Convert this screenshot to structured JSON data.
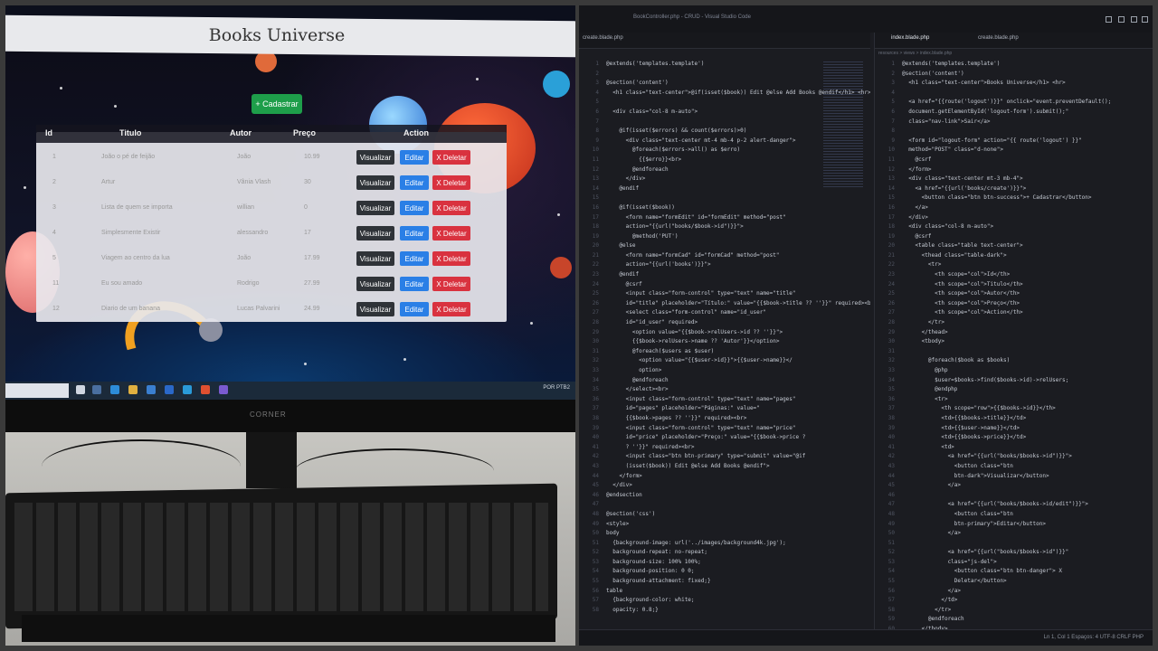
{
  "left": {
    "site_title": "Books Universe",
    "cadastrar_label": "+ Cadastrar",
    "headers": [
      "Id",
      "Titulo",
      "Autor",
      "Preço",
      "Action"
    ],
    "rows": [
      {
        "id": "1",
        "titulo": "João o pé de feijão",
        "autor": "João",
        "preco": "10.99"
      },
      {
        "id": "2",
        "titulo": "Artur",
        "autor": "Vânia Vlash",
        "preco": "30"
      },
      {
        "id": "3",
        "titulo": "Lista de quem se importa",
        "autor": "willian",
        "preco": "0"
      },
      {
        "id": "4",
        "titulo": "Simplesmente Existir",
        "autor": "alessandro",
        "preco": "17"
      },
      {
        "id": "5",
        "titulo": "Viagem ao centro da lua",
        "autor": "João",
        "preco": "17.99"
      },
      {
        "id": "11",
        "titulo": "Eu sou amado",
        "autor": "Rodrigo",
        "preco": "27.99"
      },
      {
        "id": "12",
        "titulo": "Diario de um banana",
        "autor": "Lucas Palvarini",
        "preco": "24.99"
      }
    ],
    "actions": {
      "view": "Visualizar",
      "edit": "Editar",
      "delete": "X Deletar"
    },
    "monitor_brand": "CORNER",
    "taskbar_tray": "POR PTB2"
  },
  "right": {
    "window_title": "BookController.php - CRUD - Visual Studio Code",
    "left_tab": "create.blade.php",
    "right_tabs": [
      "index.blade.php",
      "create.blade.php"
    ],
    "right_crumb": "resources > views > index.blade.php",
    "status": "Ln 1, Col 1   Espaços: 4   UTF-8   CRLF   PHP",
    "left_code": [
      "@extends('templates.template')",
      "",
      "@section('content')",
      "  <h1 class=\"text-center\">@if(isset($book)) Edit @else Add Books @endif</h1> <hr>",
      "",
      "  <div class=\"col-8 m-auto\">",
      "",
      "    @if(isset($errors) && count($errors)>0)",
      "      <div class=\"text-center mt-4 mb-4 p-2 alert-danger\">",
      "        @foreach($errors->all() as $erro)",
      "          {{$erro}}<br>",
      "        @endforeach",
      "      </div>",
      "    @endif",
      "",
      "    @if(isset($book))",
      "      <form name=\"formEdit\" id=\"formEdit\" method=\"post\"",
      "      action=\"{{url(\"books/$book->id\")}}\">",
      "        @method('PUT')",
      "    @else",
      "      <form name=\"formCad\" id=\"formCad\" method=\"post\"",
      "      action=\"{{url('books')}}\">",
      "    @endif",
      "      @csrf",
      "      <input class=\"form-control\" type=\"text\" name=\"title\"",
      "      id=\"title\" placeholder=\"Título:\" value=\"{{$book->title ?? ''}}\" required><br>",
      "      <select class=\"form-control\" name=\"id_user\"",
      "      id=\"id_user\" required>",
      "        <option value=\"{{$book->relUsers->id ?? ''}}\">",
      "        {{$book->relUsers->name ?? 'Autor'}}</option>",
      "        @foreach($users as $user)",
      "          <option value=\"{{$user->id}}\">{{$user->name}}</",
      "          option>",
      "        @endforeach",
      "      </select><br>",
      "      <input class=\"form-control\" type=\"text\" name=\"pages\"",
      "      id=\"pages\" placeholder=\"Páginas:\" value=\"",
      "      {{$book->pages ?? ''}}\" required><br>",
      "      <input class=\"form-control\" type=\"text\" name=\"price\"",
      "      id=\"price\" placeholder=\"Preço:\" value=\"{{$book->price ?",
      "      ? ''}}\" required><br>",
      "      <input class=\"btn btn-primary\" type=\"submit\" value=\"@if",
      "      (isset($book)) Edit @else Add Books @endif\">",
      "    </form>",
      "  </div>",
      "@endsection",
      "",
      "@section('css')",
      "<style>",
      "body",
      "  {background-image: url('../images/background4k.jpg');",
      "  background-repeat: no-repeat;",
      "  background-size: 100% 100%;",
      "  background-position: 0 0;",
      "  background-attachment: fixed;}",
      "table",
      "  {background-color: white;",
      "  opacity: 0.8;}"
    ],
    "right_code": [
      "@extends('templates.template')",
      "@section('content')",
      "  <h1 class=\"text-center\">Books Universe</h1> <hr>",
      "",
      "  <a href=\"{{route('logout')}}\" onclick=\"event.preventDefault();",
      "  document.getElementById('logout-form').submit();\"",
      "  class=\"nav-link\">Sair</a>",
      "",
      "  <form id=\"logout-form\" action=\"{{ route('logout') }}\"",
      "  method=\"POST\" class=\"d-none\">",
      "    @csrf",
      "  </form>",
      "  <div class=\"text-center mt-3 mb-4\">",
      "    <a href=\"{{url('books/create')}}\">",
      "      <button class=\"btn btn-success\">+ Cadastrar</button>",
      "    </a>",
      "  </div>",
      "  <div class=\"col-8 m-auto\">",
      "    @csrf",
      "    <table class=\"table text-center\">",
      "      <thead class=\"table-dark\">",
      "        <tr>",
      "          <th scope=\"col\">Id</th>",
      "          <th scope=\"col\">Titulo</th>",
      "          <th scope=\"col\">Autor</th>",
      "          <th scope=\"col\">Preço</th>",
      "          <th scope=\"col\">Action</th>",
      "        </tr>",
      "      </thead>",
      "      <tbody>",
      "",
      "        @foreach($book as $books)",
      "          @php",
      "          $user=$books->find($books->id)->relUsers;",
      "          @endphp",
      "          <tr>",
      "            <th scope=\"row\">{{$books->id}}</th>",
      "            <td>{{$books->title}}</td>",
      "            <td>{{$user->name}}</td>",
      "            <td>{{$books->price}}</td>",
      "            <td>",
      "              <a href=\"{{url(\"books/$books->id\")}}\">",
      "                <button class=\"btn",
      "                btn-dark\">Visualizar</button>",
      "              </a>",
      "",
      "              <a href=\"{{url(\"books/$books->id/edit\")}}\">",
      "                <button class=\"btn",
      "                btn-primary\">Editar</button>",
      "              </a>",
      "",
      "              <a href=\"{{url(\"books/$books->id\")}}\"",
      "              class=\"js-del\">",
      "                <button class=\"btn btn-danger\"> X",
      "                Deletar</button>",
      "              </a>",
      "            </td>",
      "          </tr>",
      "        @endforeach",
      "      </tbody>"
    ]
  }
}
